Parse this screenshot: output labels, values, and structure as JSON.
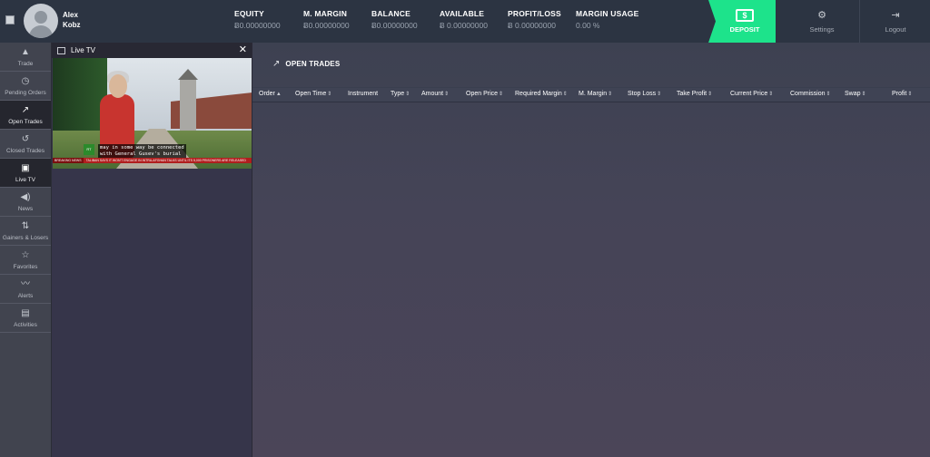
{
  "header": {
    "user": {
      "first_name": "Alex",
      "last_name": "Kobz"
    },
    "stats": [
      {
        "label": "EQUITY",
        "value": "Ƀ0.00000000"
      },
      {
        "label": "M. MARGIN",
        "value": "Ƀ0.00000000"
      },
      {
        "label": "BALANCE",
        "value": "Ƀ0.00000000"
      },
      {
        "label": "AVAILABLE",
        "value": "Ƀ 0.00000000"
      },
      {
        "label": "PROFIT/LOSS",
        "value": "Ƀ 0.00000000"
      },
      {
        "label": "MARGIN USAGE",
        "value": "0.00 %"
      }
    ],
    "deposit_label": "DEPOSIT",
    "deposit_icon_text": "$",
    "settings_label": "Settings",
    "logout_label": "Logout"
  },
  "sidebar": {
    "items": [
      {
        "label": "Trade",
        "icon": "chart-icon"
      },
      {
        "label": "Pending Orders",
        "icon": "clock-icon"
      },
      {
        "label": "Open Trades",
        "icon": "open-trades-icon"
      },
      {
        "label": "Closed Trades",
        "icon": "closed-trades-icon"
      },
      {
        "label": "Live TV",
        "icon": "tv-icon"
      },
      {
        "label": "News",
        "icon": "megaphone-icon"
      },
      {
        "label": "Gainers & Losers",
        "icon": "gainers-icon"
      },
      {
        "label": "Favorites",
        "icon": "star-icon"
      },
      {
        "label": "Alerts",
        "icon": "alert-icon"
      },
      {
        "label": "Activities",
        "icon": "activities-icon"
      }
    ]
  },
  "tv": {
    "title": "Live TV",
    "caption_line1": "may in some way be connected",
    "caption_line2": "with General Gusev's burial",
    "ticker_tag": "BREAKING NEWS",
    "ticker_text": "TALIBAN SAYS IT WON'T ENGAGE IN INTRA-AFGHAN TALKS UNTIL ITS 5,000 PRISONERS ARE RELEASED"
  },
  "main": {
    "title": "OPEN TRADES",
    "columns": [
      "Order",
      "Open Time",
      "Instrument",
      "Type",
      "Amount",
      "Open Price",
      "Required Margin",
      "M. Margin",
      "Stop Loss",
      "Take Profit",
      "Current Price",
      "Commission",
      "Swap",
      "Profit"
    ]
  },
  "colors": {
    "accent": "#1de38b",
    "header_bg": "#2c3442",
    "sidebar_bg": "#41444f"
  }
}
